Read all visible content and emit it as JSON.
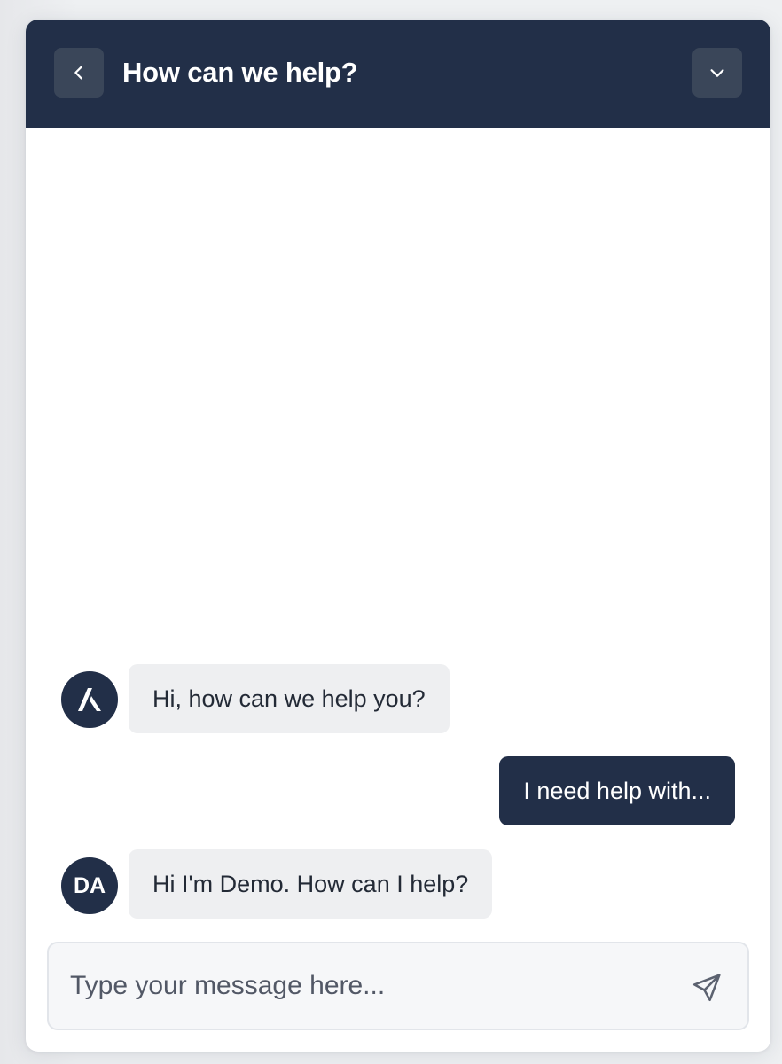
{
  "header": {
    "title": "How can we help?",
    "back_icon": "chevron-left-icon",
    "collapse_icon": "chevron-down-icon"
  },
  "messages": [
    {
      "sender": "agent",
      "avatar": "logo",
      "text": "Hi, how can we help you?"
    },
    {
      "sender": "user",
      "text": "I need help with..."
    },
    {
      "sender": "agent",
      "avatar_initials": "DA",
      "text": "Hi I'm Demo. How can I help?"
    }
  ],
  "composer": {
    "placeholder": "Type your message here...",
    "send_icon": "send-icon"
  },
  "colors": {
    "brand": "#222f48",
    "agent_bubble": "#eeeff1",
    "input_bg": "#f6f7f9"
  }
}
